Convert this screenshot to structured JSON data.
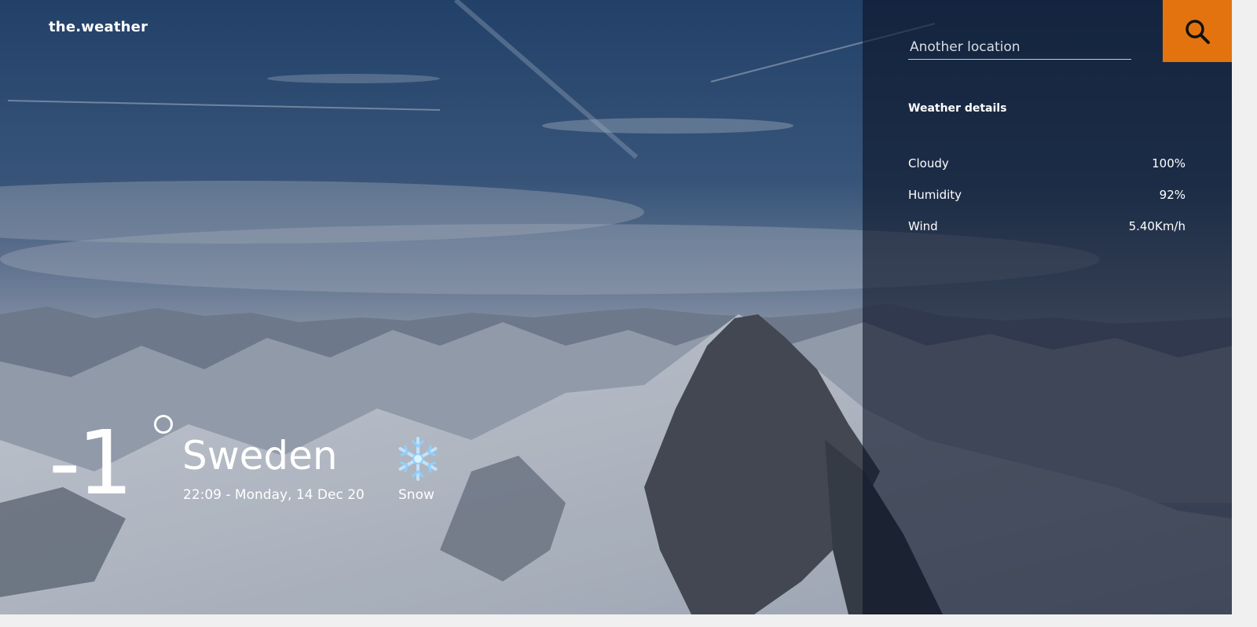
{
  "brand": "the.weather",
  "search": {
    "placeholder": "Another location",
    "icon": "search-icon",
    "button_color": "#e3730f"
  },
  "details": {
    "title": "Weather details",
    "rows": [
      {
        "label": "Cloudy",
        "value": "100%"
      },
      {
        "label": "Humidity",
        "value": "92%"
      },
      {
        "label": "Wind",
        "value": "5.40Km/h"
      }
    ]
  },
  "current": {
    "temperature": "-1",
    "city": "Sweden",
    "datetime": "22:09 - Monday, 14 Dec 20",
    "condition": "Snow",
    "condition_icon": "snowflake-icon"
  }
}
